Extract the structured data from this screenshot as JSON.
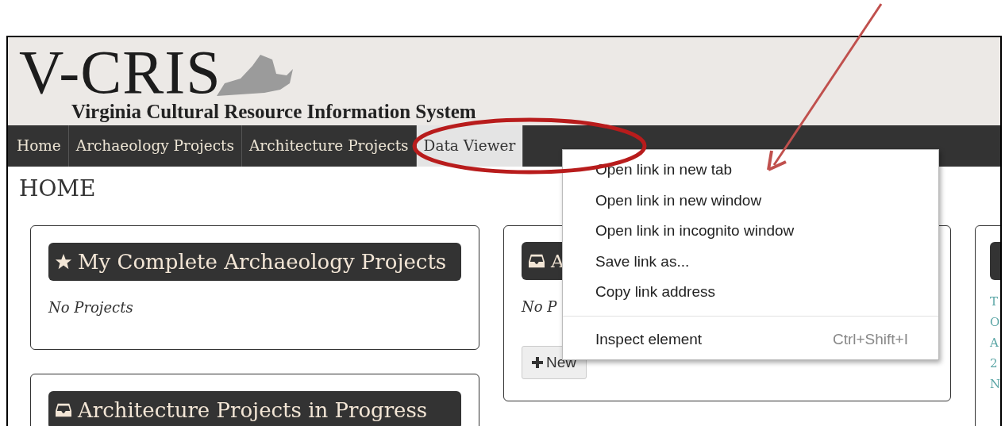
{
  "header": {
    "logo_text": "V-CRIS",
    "subtitle": "Virginia Cultural Resource Information System"
  },
  "nav": {
    "tabs": [
      {
        "label": "Home",
        "selected": false
      },
      {
        "label": "Archaeology Projects",
        "selected": false
      },
      {
        "label": "Architecture Projects",
        "selected": false
      },
      {
        "label": "Data Viewer",
        "selected": true
      }
    ]
  },
  "page_title": "HOME",
  "left_column": [
    {
      "title": "My Complete Archaeology Projects",
      "body": "No Projects"
    },
    {
      "title": "Architecture Projects in Progress"
    }
  ],
  "middle_card": {
    "title": "A",
    "body": "No P",
    "button": "New"
  },
  "right_card": {
    "lines": [
      "T",
      "O",
      "A",
      "2",
      "N"
    ]
  },
  "context_menu": {
    "items": [
      {
        "kind": "item",
        "label": "Open link in new tab"
      },
      {
        "kind": "item",
        "label": "Open link in new window"
      },
      {
        "kind": "item",
        "label": "Open link in incognito window"
      },
      {
        "kind": "item",
        "label": "Save link as..."
      },
      {
        "kind": "item",
        "label": "Copy link address"
      },
      {
        "kind": "separator"
      },
      {
        "kind": "item",
        "label": "Inspect element",
        "shortcut": "Ctrl+Shift+I"
      }
    ]
  }
}
